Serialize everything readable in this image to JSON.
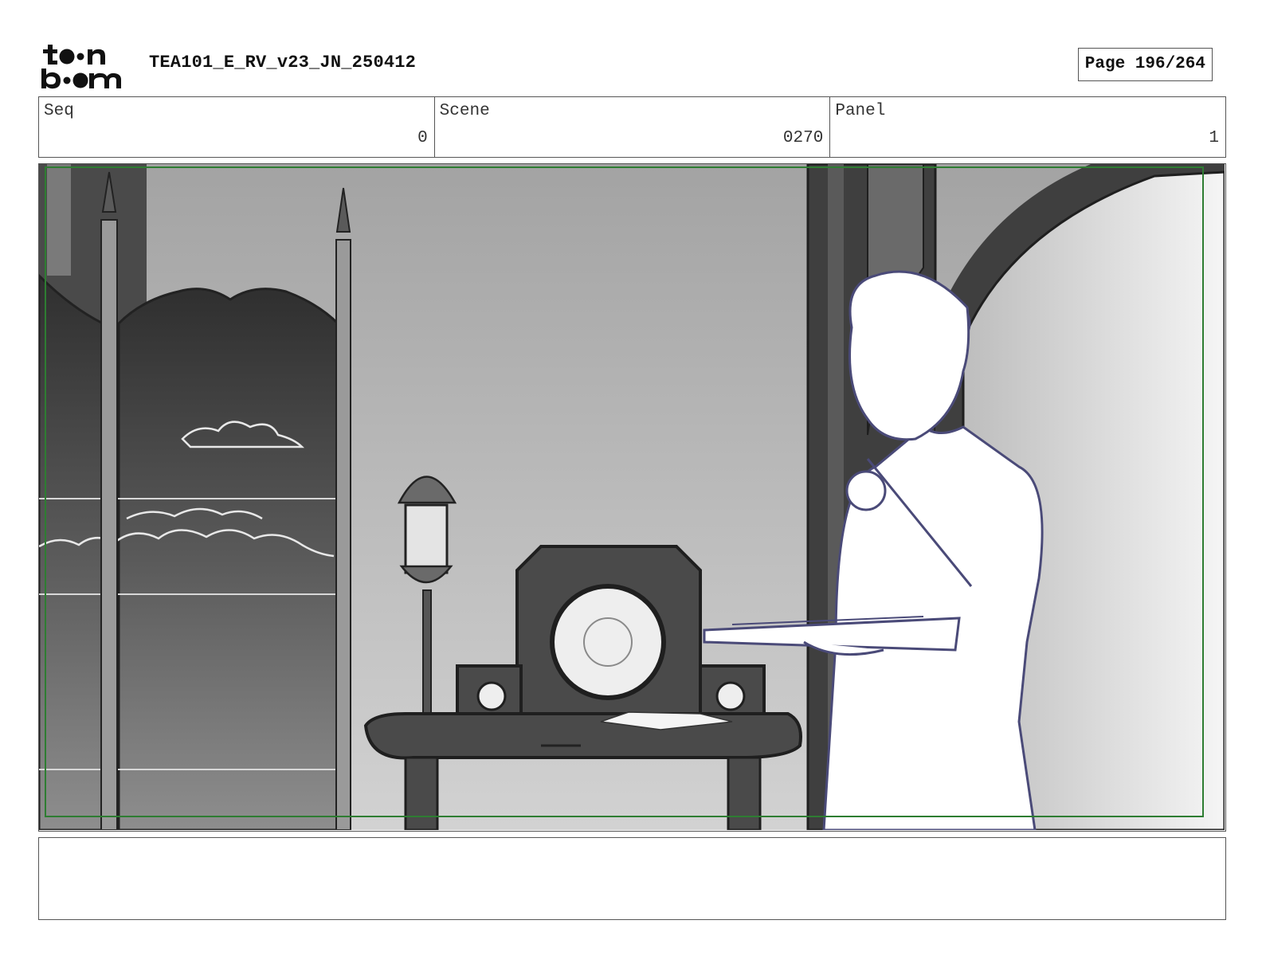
{
  "header": {
    "logo": "toonboom",
    "title": "TEA101_E_RV_v23_JN_250412",
    "page_label": "Page 196/264"
  },
  "info": {
    "seq": {
      "label": "Seq",
      "value": "0"
    },
    "scene": {
      "label": "Scene",
      "value": "0270"
    },
    "panel": {
      "label": "Panel",
      "value": "1"
    }
  },
  "panel_image": {
    "description_icon": "storyboard-panel-illustration",
    "safe_frame_color": "#2e7d32",
    "character_line_color": "#4a4a78"
  },
  "notes": {
    "text": ""
  }
}
